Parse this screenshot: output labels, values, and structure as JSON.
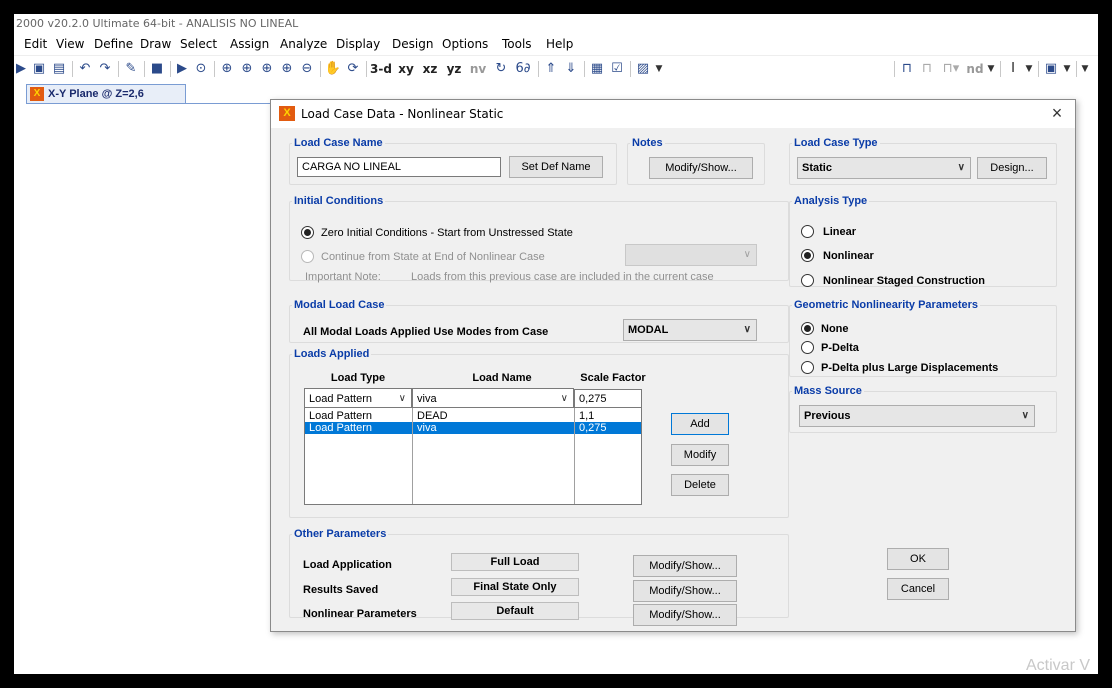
{
  "app": {
    "title": "2000 v20.2.0 Ultimate 64-bit - ANALISIS NO LINEAL",
    "menu": [
      "Edit",
      "View",
      "Define",
      "Draw",
      "Select",
      "Assign",
      "Analyze",
      "Display",
      "Design",
      "Options",
      "Tools",
      "Help"
    ],
    "toolbar_text": {
      "view3d": "3-d",
      "xy": "xy",
      "xz": "xz",
      "yz": "yz",
      "nv": "nv",
      "nd": "nd"
    },
    "view_tab": "X-Y Plane @ Z=2,6",
    "watermark": "Activar V"
  },
  "dialog": {
    "title": "Load Case Data - Nonlinear Static",
    "close": "×",
    "load_case_name": {
      "legend": "Load Case Name",
      "value": "CARGA NO LINEAL",
      "set_def_name": "Set Def Name"
    },
    "notes": {
      "legend": "Notes",
      "button": "Modify/Show..."
    },
    "load_case_type": {
      "legend": "Load Case Type",
      "value": "Static",
      "design_button": "Design..."
    },
    "initial_conditions": {
      "legend": "Initial Conditions",
      "option_zero": "Zero Initial Conditions - Start from Unstressed State",
      "option_continue": "Continue from State at End of Nonlinear Case",
      "note_label": "Important Note:",
      "note_text": "Loads from this previous case are included in the current case",
      "selected": "zero"
    },
    "analysis_type": {
      "legend": "Analysis Type",
      "options": [
        "Linear",
        "Nonlinear",
        "Nonlinear Staged Construction"
      ],
      "selected": "Nonlinear"
    },
    "modal_load_case": {
      "legend": "Modal Load Case",
      "label": "All Modal Loads Applied Use Modes from Case",
      "value": "MODAL"
    },
    "geometric_nonlinearity": {
      "legend": "Geometric Nonlinearity Parameters",
      "options": [
        "None",
        "P-Delta",
        "P-Delta plus Large Displacements"
      ],
      "selected": "None"
    },
    "loads_applied": {
      "legend": "Loads Applied",
      "headers": {
        "type": "Load Type",
        "name": "Load Name",
        "factor": "Scale Factor"
      },
      "current": {
        "type": "Load Pattern",
        "name": "viva",
        "factor": "0,275"
      },
      "rows": [
        {
          "type": "Load Pattern",
          "name": "DEAD",
          "factor": "1,1",
          "selected": false
        },
        {
          "type": "Load Pattern",
          "name": "viva",
          "factor": "0,275",
          "selected": true
        }
      ],
      "buttons": {
        "add": "Add",
        "modify": "Modify",
        "delete": "Delete"
      }
    },
    "mass_source": {
      "legend": "Mass Source",
      "value": "Previous"
    },
    "other_parameters": {
      "legend": "Other Parameters",
      "load_application": {
        "label": "Load Application",
        "value": "Full Load",
        "button": "Modify/Show..."
      },
      "results_saved": {
        "label": "Results Saved",
        "value": "Final State Only",
        "button": "Modify/Show..."
      },
      "nonlinear_parameters": {
        "label": "Nonlinear Parameters",
        "value": "Default",
        "button": "Modify/Show..."
      }
    },
    "ok": "OK",
    "cancel": "Cancel"
  }
}
